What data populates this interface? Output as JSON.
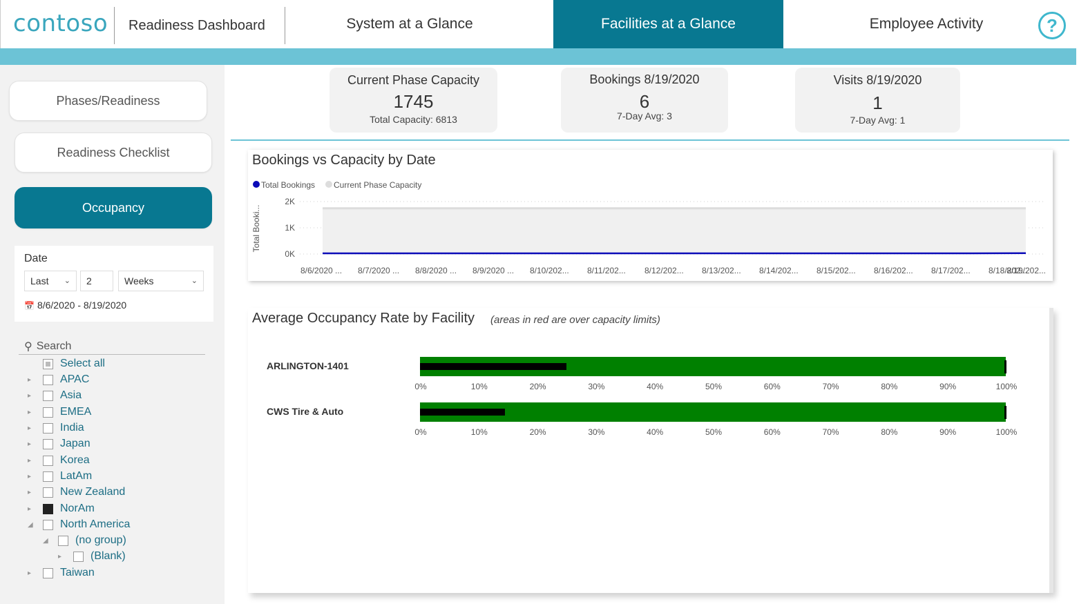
{
  "header": {
    "logo": "contoso",
    "title": "Readiness Dashboard",
    "tabs": [
      {
        "label": "System at a Glance"
      },
      {
        "label": "Facilities at a Glance"
      },
      {
        "label": "Employee Activity"
      }
    ],
    "help": "?"
  },
  "sidebar": {
    "buttons": [
      "Phases/Readiness",
      "Readiness Checklist",
      "Occupancy"
    ],
    "date": {
      "label": "Date",
      "relative": "Last",
      "count": "2",
      "unit": "Weeks",
      "range": "8/6/2020 - 8/19/2020"
    },
    "search_placeholder": "Search",
    "items": [
      {
        "label": "Select all"
      },
      {
        "label": "APAC"
      },
      {
        "label": "Asia"
      },
      {
        "label": "EMEA"
      },
      {
        "label": "India"
      },
      {
        "label": "Japan"
      },
      {
        "label": "Korea"
      },
      {
        "label": "LatAm"
      },
      {
        "label": "New Zealand"
      },
      {
        "label": "NorAm"
      },
      {
        "label": "North America"
      },
      {
        "label": "(no group)"
      },
      {
        "label": "(Blank)"
      },
      {
        "label": "Taiwan"
      }
    ]
  },
  "kpis": [
    {
      "title": "Current Phase Capacity",
      "value": "1745",
      "sub": "Total Capacity: 6813"
    },
    {
      "title": "Bookings 8/19/2020",
      "value": "6",
      "sub": "7-Day Avg: 3"
    },
    {
      "title": "Visits 8/19/2020",
      "value": "1",
      "sub": "7-Day Avg: 1"
    }
  ],
  "colors": {
    "accent": "#087891",
    "accent_light": "#6cc3d6",
    "bookings_line": "#0b0bb8",
    "capacity_area": "#f0f0f0",
    "bar_fill": "#008000",
    "bar_value": "#000000"
  },
  "chart_data": [
    {
      "type": "area",
      "title": "Bookings vs Capacity by Date",
      "ylabel": "Total Booki...",
      "xlabel": "",
      "y_ticks": [
        "2K",
        "1K",
        "0K"
      ],
      "ylim": [
        0,
        2000
      ],
      "categories": [
        "8/6/2020 ...",
        "8/7/2020 ...",
        "8/8/2020 ...",
        "8/9/2020 ...",
        "8/10/202...",
        "8/11/202...",
        "8/12/202...",
        "8/13/202...",
        "8/14/202...",
        "8/15/202...",
        "8/16/202...",
        "8/17/202...",
        "8/18/202...",
        "8/19/202..."
      ],
      "series": [
        {
          "name": "Total Bookings",
          "values": [
            0,
            0,
            0,
            0,
            0,
            0,
            0,
            0,
            0,
            0,
            0,
            0,
            0,
            6
          ]
        },
        {
          "name": "Current Phase Capacity",
          "values": [
            1745,
            1745,
            1745,
            1745,
            1745,
            1745,
            1745,
            1745,
            1745,
            1745,
            1745,
            1745,
            1745,
            1745
          ]
        }
      ],
      "legend": "top-left",
      "grid": true
    },
    {
      "type": "bar",
      "title": "Average Occupancy Rate by Facility",
      "note": "(areas in red are over capacity limits)",
      "categories": [
        "ARLINGTON-1401",
        "CWS Tire & Auto"
      ],
      "values": [
        0.25,
        0.145
      ],
      "target": [
        1.0,
        1.0
      ],
      "ticks": [
        "0%",
        "10%",
        "20%",
        "30%",
        "40%",
        "50%",
        "60%",
        "70%",
        "80%",
        "90%",
        "100%"
      ]
    }
  ]
}
